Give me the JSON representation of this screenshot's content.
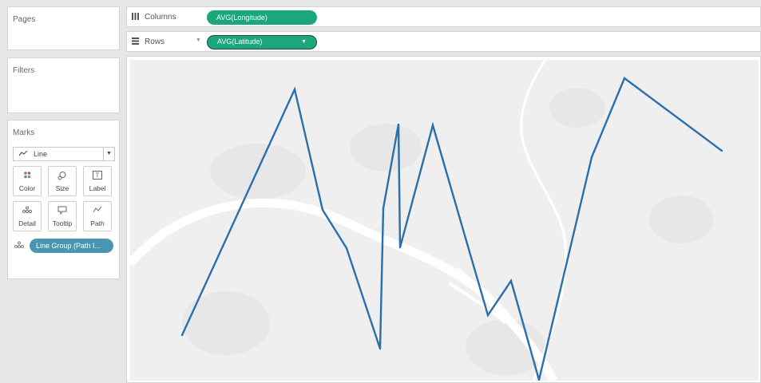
{
  "sidebar": {
    "pages_title": "Pages",
    "filters_title": "Filters",
    "marks_title": "Marks",
    "mark_type": "Line",
    "mark_type_icon": "line-chart-icon",
    "buttons": {
      "color": {
        "label": "Color",
        "icon": "color-dots-icon"
      },
      "size": {
        "label": "Size",
        "icon": "size-shapes-icon"
      },
      "label": {
        "label": "Label",
        "icon": "text-label-icon"
      },
      "detail": {
        "label": "Detail",
        "icon": "detail-dots-icon"
      },
      "tooltip": {
        "label": "Tooltip",
        "icon": "tooltip-speech-icon"
      },
      "path": {
        "label": "Path",
        "icon": "path-line-icon"
      }
    },
    "detail_field": "Line Group (Path I..."
  },
  "shelves": {
    "columns_label": "Columns",
    "columns_pill": "AVG(Longitude)",
    "rows_label": "Rows",
    "rows_pill": "AVG(Latitude)"
  },
  "colors": {
    "pill_green": "#1aa77b",
    "pill_blue": "#4996b2",
    "line": "#2a6fad",
    "map_bg": "#efefef",
    "river": "#ffffff"
  }
}
